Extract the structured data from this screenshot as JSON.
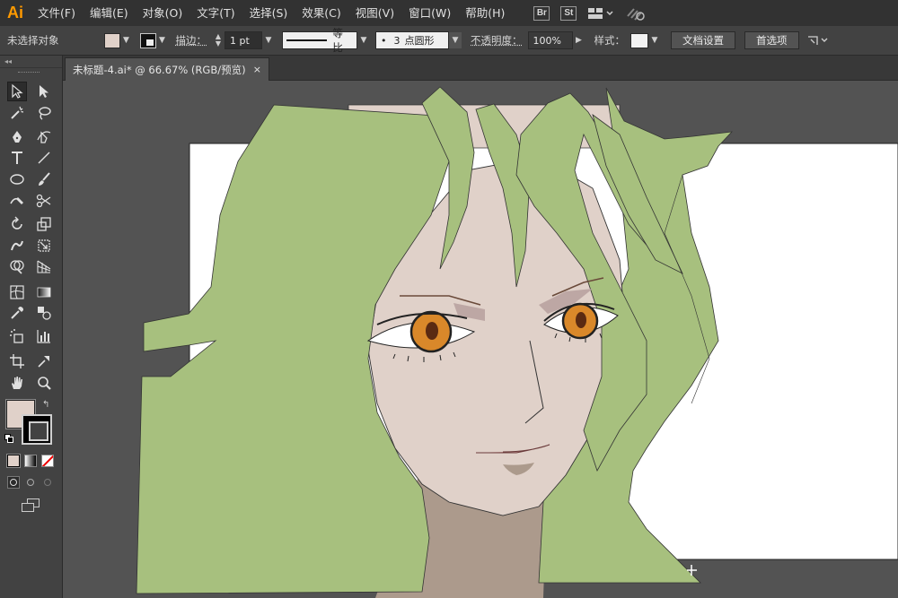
{
  "app": {
    "logo": "Ai"
  },
  "menu": [
    "文件(F)",
    "编辑(E)",
    "对象(O)",
    "文字(T)",
    "选择(S)",
    "效果(C)",
    "视图(V)",
    "窗口(W)",
    "帮助(H)"
  ],
  "menubar_icons": {
    "bridge": "Br",
    "stock": "St"
  },
  "controlbar": {
    "selection_status": "未选择对象",
    "stroke_label": "描边：",
    "stroke_weight": "1 pt",
    "stroke_profile": "等比",
    "brush_size": "3",
    "brush_shape": "点圆形",
    "opacity_label": "不透明度：",
    "opacity_value": "100%",
    "style_label": "样式：",
    "doc_setup_label": "文档设置",
    "prefs_label": "首选项"
  },
  "document_tab": {
    "title": "未标题-4.ai* @ 66.67% (RGB/预览)",
    "close": "×"
  },
  "colors": {
    "fill": "#e0d1c9",
    "stroke": "#000000",
    "hair": "#a7c07e",
    "skin": "#e0d1c9",
    "neck": "#ac9a8c",
    "iris": "#d9882a",
    "pupil": "#5a2a12",
    "lips": "#c99a98",
    "artboard": "#ffffff",
    "pasteboard": "#535353"
  }
}
